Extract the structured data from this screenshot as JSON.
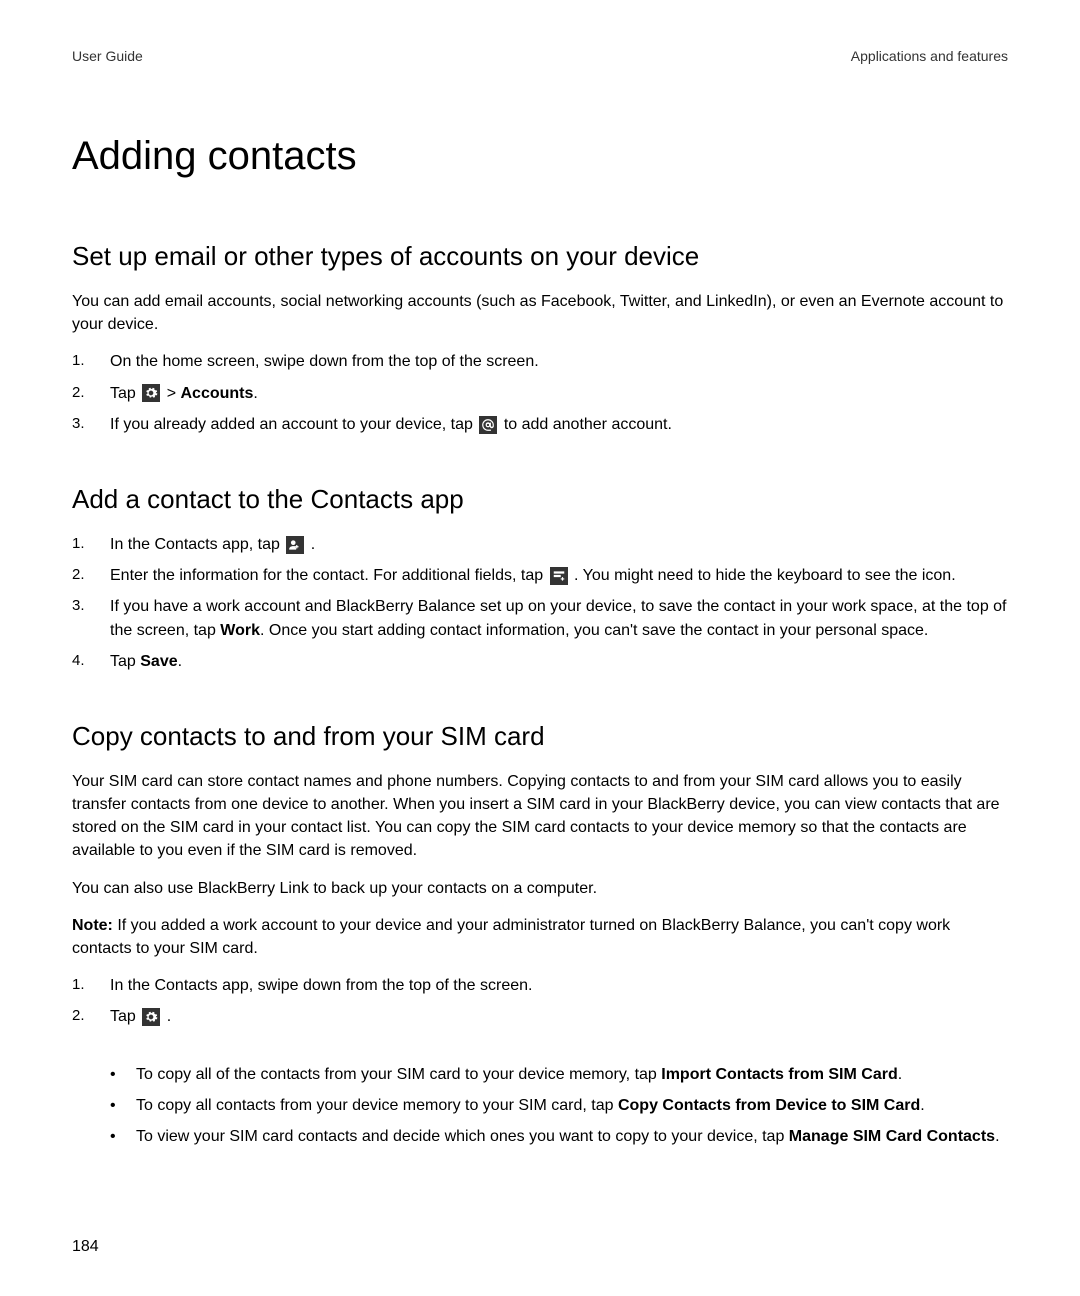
{
  "header": {
    "left": "User Guide",
    "right": "Applications and features"
  },
  "title": "Adding contacts",
  "sections": {
    "setup": {
      "heading": "Set up email or other types of accounts on your device",
      "intro": "You can add email accounts, social networking accounts (such as Facebook, Twitter, and LinkedIn), or even an Evernote account to your device.",
      "step1": "On the home screen, swipe down from the top of the screen.",
      "step2_pre": "Tap ",
      "step2_sep": " > ",
      "step2_bold": "Accounts",
      "step2_dot": ".",
      "step3_pre": "If you already added an account to your device, tap ",
      "step3_post": " to add another account."
    },
    "add_contact": {
      "heading": "Add a contact to the Contacts app",
      "step1_pre": "In the Contacts app, tap ",
      "step1_post": " .",
      "step2_pre": "Enter the information for the contact. For additional fields, tap ",
      "step2_post": " . You might need to hide the keyboard to see the icon.",
      "step3_pre": "If you have a work account and BlackBerry Balance set up on your device, to save the contact in your work space, at the top of the screen, tap ",
      "step3_bold": "Work",
      "step3_post": ". Once you start adding contact information, you can't save the contact in your personal space.",
      "step4_pre": "Tap ",
      "step4_bold": "Save",
      "step4_dot": "."
    },
    "sim": {
      "heading": "Copy contacts to and from your SIM card",
      "p1": "Your SIM card can store contact names and phone numbers. Copying contacts to and from your SIM card allows you to easily transfer contacts from one device to another. When you insert a SIM card in your BlackBerry device, you can view contacts that are stored on the SIM card in your contact list. You can copy the SIM card contacts to your device memory so that the contacts are available to you even if the SIM card is removed.",
      "p2": "You can also use BlackBerry Link to back up your contacts on a computer.",
      "note_label": "Note:",
      "note_text": " If you added a work account to your device and your administrator turned on BlackBerry Balance, you can't copy work contacts to your SIM card.",
      "step1": "In the Contacts app, swipe down from the top of the screen.",
      "step2_pre": "Tap ",
      "step2_post": " .",
      "b1_pre": "To copy all of the contacts from your SIM card to your device memory, tap ",
      "b1_bold": "Import Contacts from SIM Card",
      "b1_dot": ".",
      "b2_pre": "To copy all contacts from your device memory to your SIM card, tap ",
      "b2_bold": "Copy Contacts from Device to SIM Card",
      "b2_dot": ".",
      "b3_pre": "To view your SIM card contacts and decide which ones you want to copy to your device, tap ",
      "b3_bold": "Manage SIM Card Contacts",
      "b3_dot": "."
    }
  },
  "page_number": "184"
}
